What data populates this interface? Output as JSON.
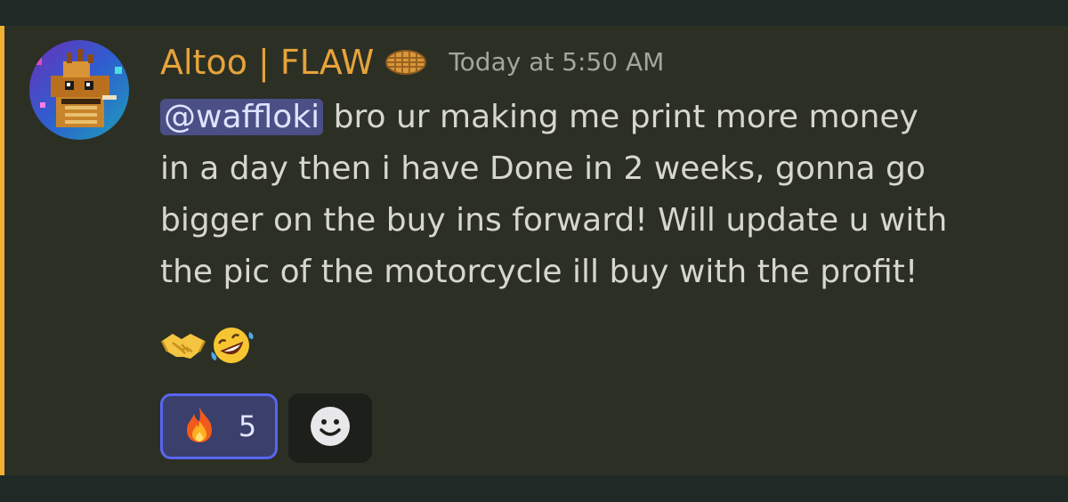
{
  "message": {
    "author": "Altoo | FLAW",
    "badge_icon": "waffle-icon",
    "timestamp": "Today at 5:50 AM",
    "mention": "@waffloki",
    "lines": [
      " bro ur making me print more money",
      "in a day then i have Done in 2 weeks, gonna go",
      "bigger on the buy ins forward! Will update u with",
      "the pic of the motorcycle ill buy with the profit!"
    ],
    "emojis": [
      "handshake-emoji",
      "rofl-emoji"
    ]
  },
  "reactions": [
    {
      "emoji": "fire-emoji",
      "count": "5"
    }
  ],
  "add_reaction_icon": "smiley-add-reaction-icon",
  "colors": {
    "background": "#1f2a26",
    "message_bg": "#2c2f24",
    "accent": "#f0b132",
    "username": "#e6a33a",
    "timestamp": "#a3a69c",
    "text": "#d6d7d0",
    "mention_bg": "#4a4f86",
    "reaction_border": "#5865f2",
    "reaction_bg": "#3a3f6b"
  }
}
